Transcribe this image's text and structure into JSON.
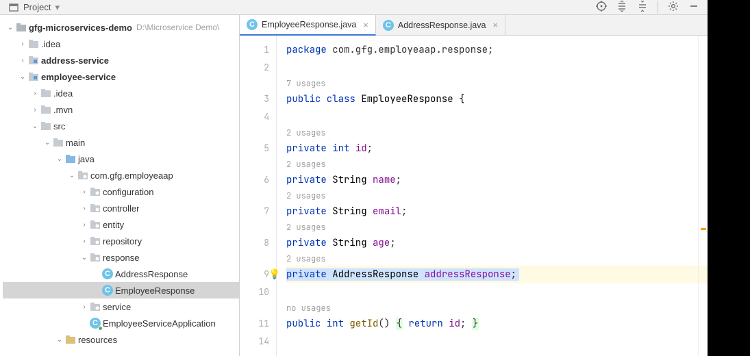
{
  "toolbar": {
    "project_label": "Project"
  },
  "tree": {
    "root": {
      "name": "gfg-microservices-demo",
      "path": "D:\\Microservice Demo\\"
    },
    "idea": ".idea",
    "addr": "address-service",
    "emp": "employee-service",
    "emp_idea": ".idea",
    "emp_mvn": ".mvn",
    "src": "src",
    "main": "main",
    "java": "java",
    "pkg": "com.gfg.employeaap",
    "configuration": "configuration",
    "controller": "controller",
    "entity": "entity",
    "repository": "repository",
    "response": "response",
    "address_response": "AddressResponse",
    "employee_response": "EmployeeResponse",
    "service": "service",
    "app_class": "EmployeeServiceApplication",
    "resources": "resources"
  },
  "tabs": {
    "active": "EmployeeResponse.java",
    "other": "AddressResponse.java"
  },
  "usages": {
    "u7": "7 usages",
    "u2": "2 usages",
    "u0": "no usages"
  },
  "code": {
    "l1_pkg": "package",
    "l1_rest": " com.gfg.employeaap.response;",
    "l3_a": "public",
    "l3_b": " class",
    "l3_c": " EmployeeResponse {",
    "l5_a": "private",
    "l5_b": " int",
    "l5_c": " id",
    "l6_a": "private",
    "l6_b": " String ",
    "l6_c": "name",
    "l7_a": "private",
    "l7_b": " String ",
    "l7_c": "email",
    "l8_a": "private",
    "l8_b": " String ",
    "l8_c": "age",
    "l9_a": "private",
    "l9_b": " AddressResponse ",
    "l9_c": "addressResponse",
    "l11_a": "public",
    "l11_b": " int",
    "l11_c": " getId",
    "l11_d": "() ",
    "l11_e": "{",
    "l11_f": " return",
    "l11_g": " id",
    "l11_h": "; ",
    "l11_i": "}"
  },
  "gutter": [
    "1",
    "2",
    "",
    "3",
    "4",
    "",
    "5",
    "",
    "6",
    "",
    "7",
    "",
    "8",
    "",
    "9",
    "10",
    "",
    "11",
    "14"
  ]
}
